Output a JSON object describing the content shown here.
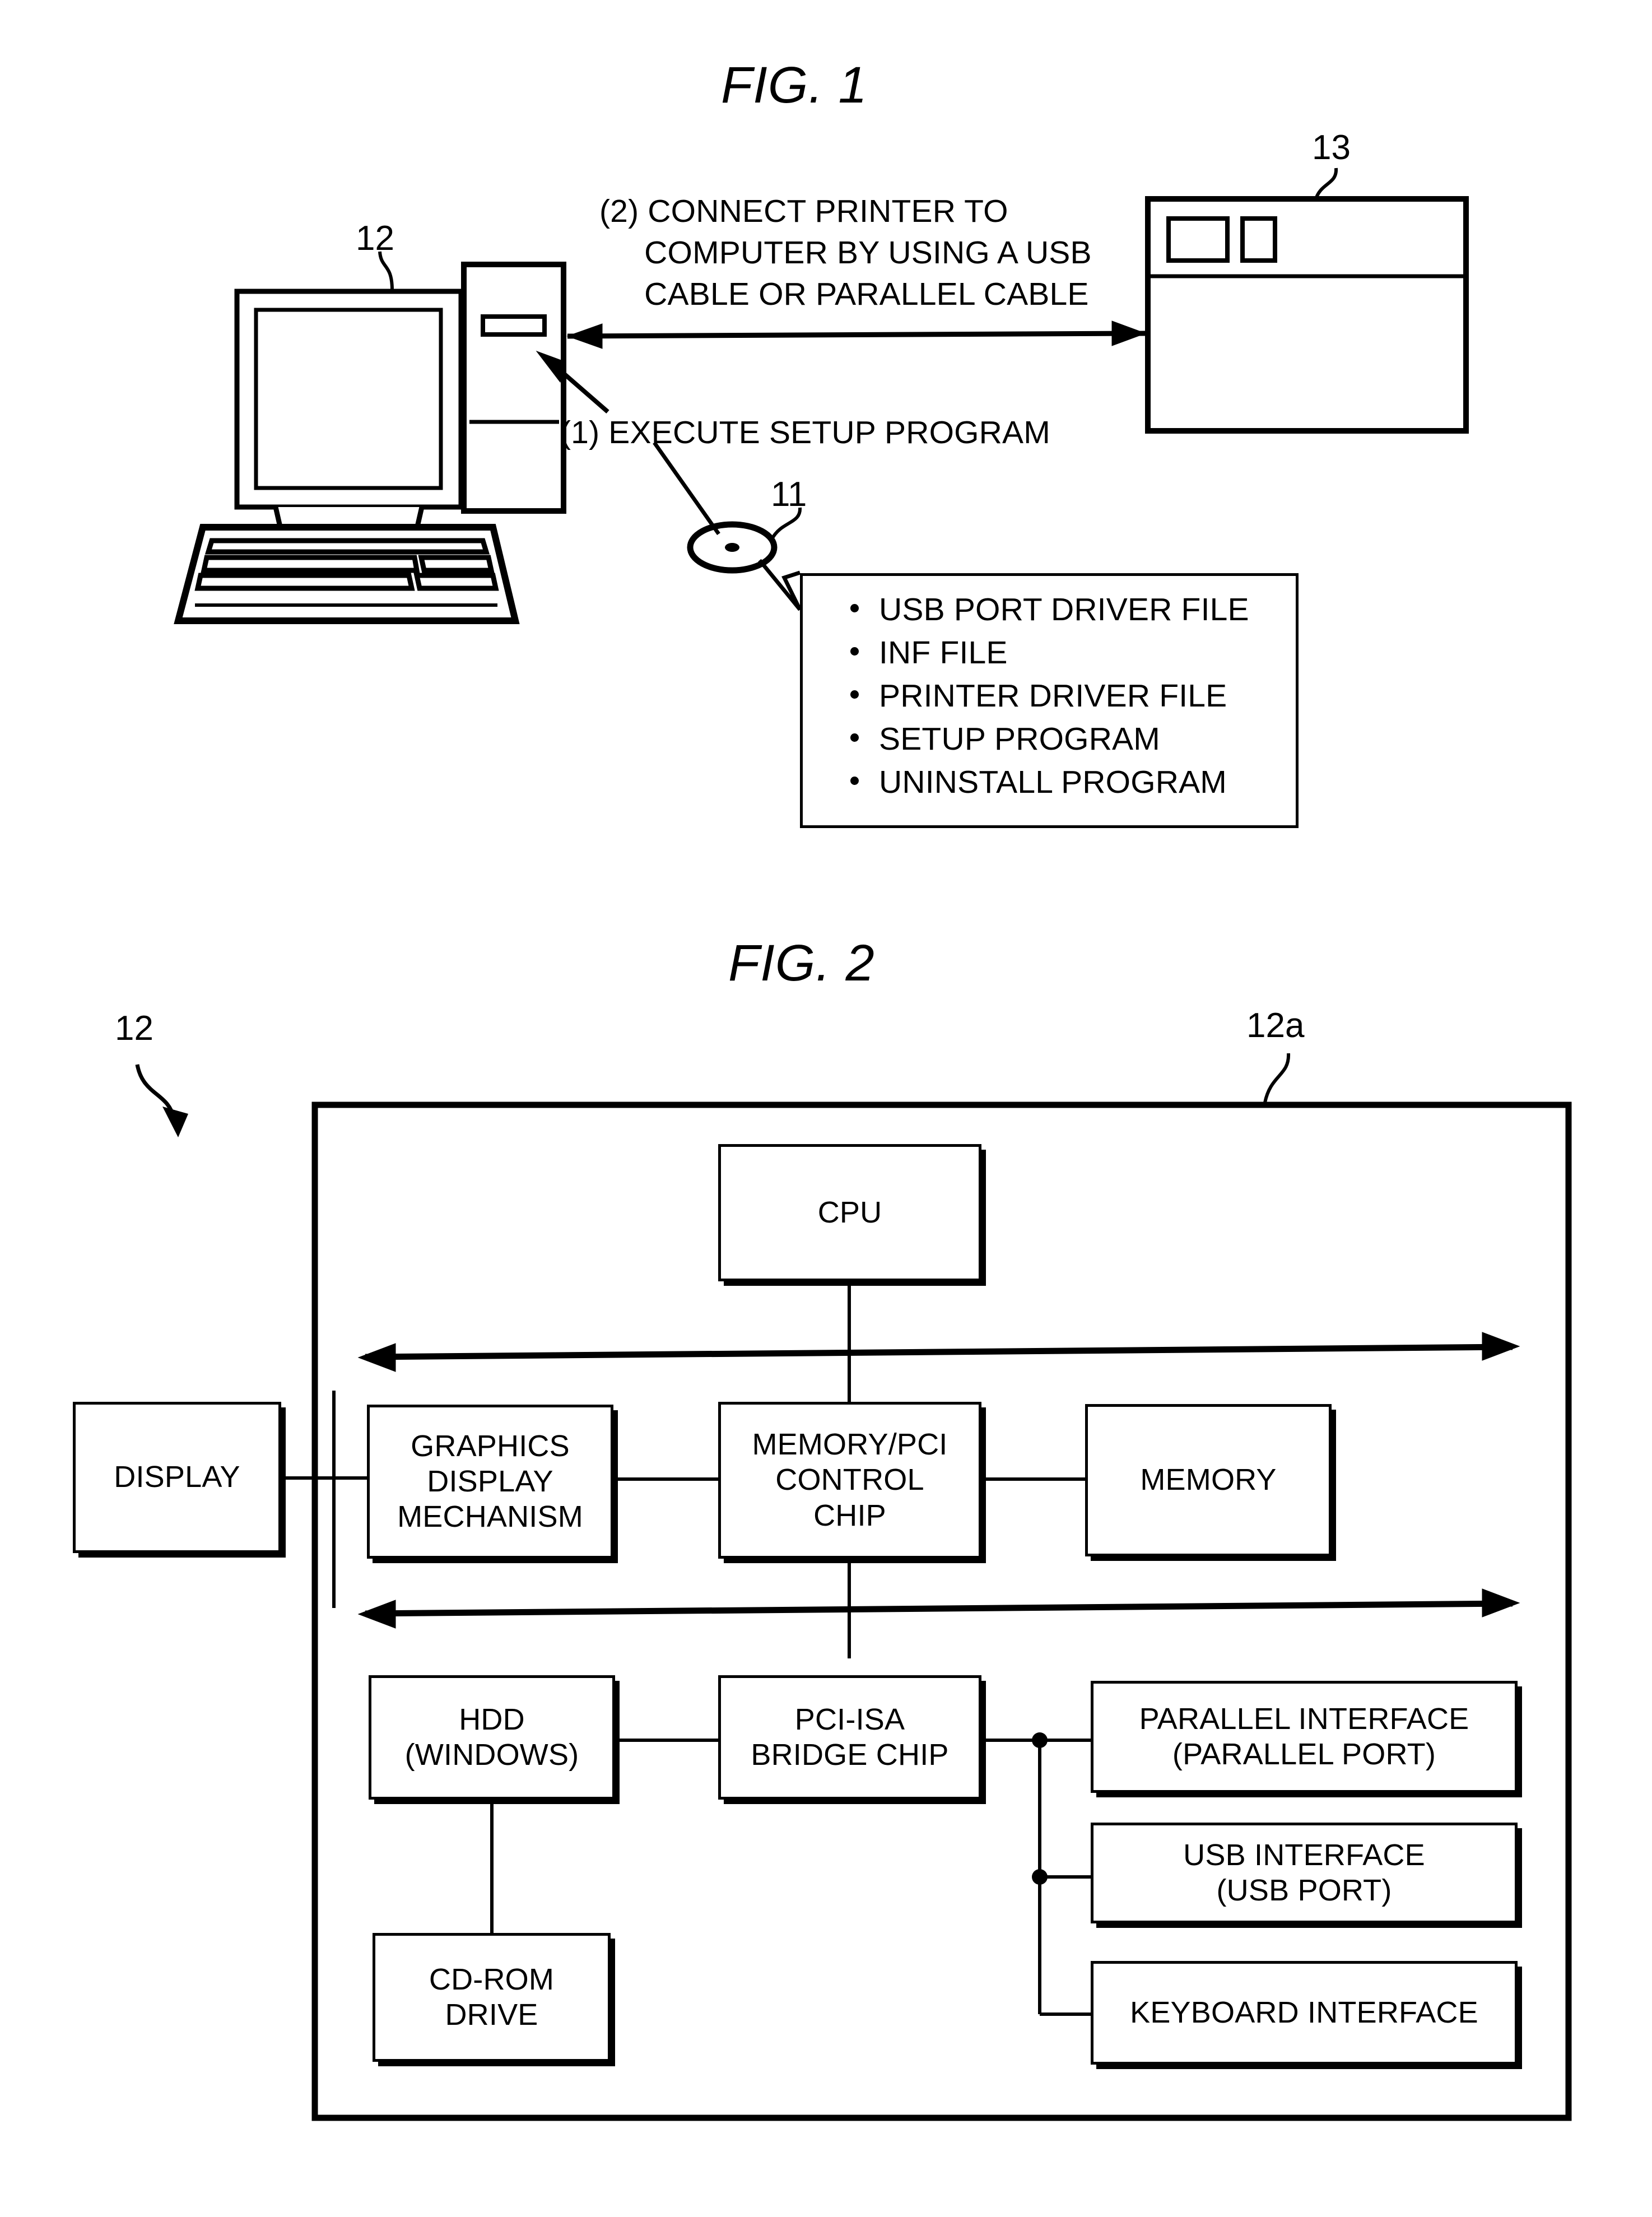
{
  "figures": {
    "fig1": {
      "title": "FIG. 1",
      "refs": {
        "computer": "12",
        "printer": "13",
        "cd": "11"
      },
      "callouts": {
        "connect": "(2) CONNECT PRINTER TO\n     COMPUTER BY USING A USB\n     CABLE OR PARALLEL CABLE",
        "execute": "(1) EXECUTE SETUP PROGRAM"
      },
      "cd_contents": [
        "USB PORT DRIVER FILE",
        "INF FILE",
        "PRINTER DRIVER FILE",
        "SETUP PROGRAM",
        "UNINSTALL PROGRAM"
      ]
    },
    "fig2": {
      "title": "FIG. 2",
      "refs": {
        "computer": "12",
        "main_unit": "12a"
      },
      "blocks": {
        "cpu": "CPU",
        "display": "DISPLAY",
        "graphics": "GRAPHICS\nDISPLAY\nMECHANISM",
        "memory_pci_control_chip": "MEMORY/PCI\nCONTROL\nCHIP",
        "memory": "MEMORY",
        "hdd": "HDD\n(WINDOWS)",
        "bridge": "PCI-ISA\nBRIDGE CHIP",
        "cdrom": "CD-ROM\nDRIVE",
        "parallel_interface": "PARALLEL INTERFACE\n(PARALLEL PORT)",
        "usb_interface": "USB INTERFACE\n(USB PORT)",
        "keyboard_interface": "KEYBOARD INTERFACE"
      }
    }
  },
  "colors": {
    "ink": "#000000",
    "paper": "#ffffff"
  }
}
